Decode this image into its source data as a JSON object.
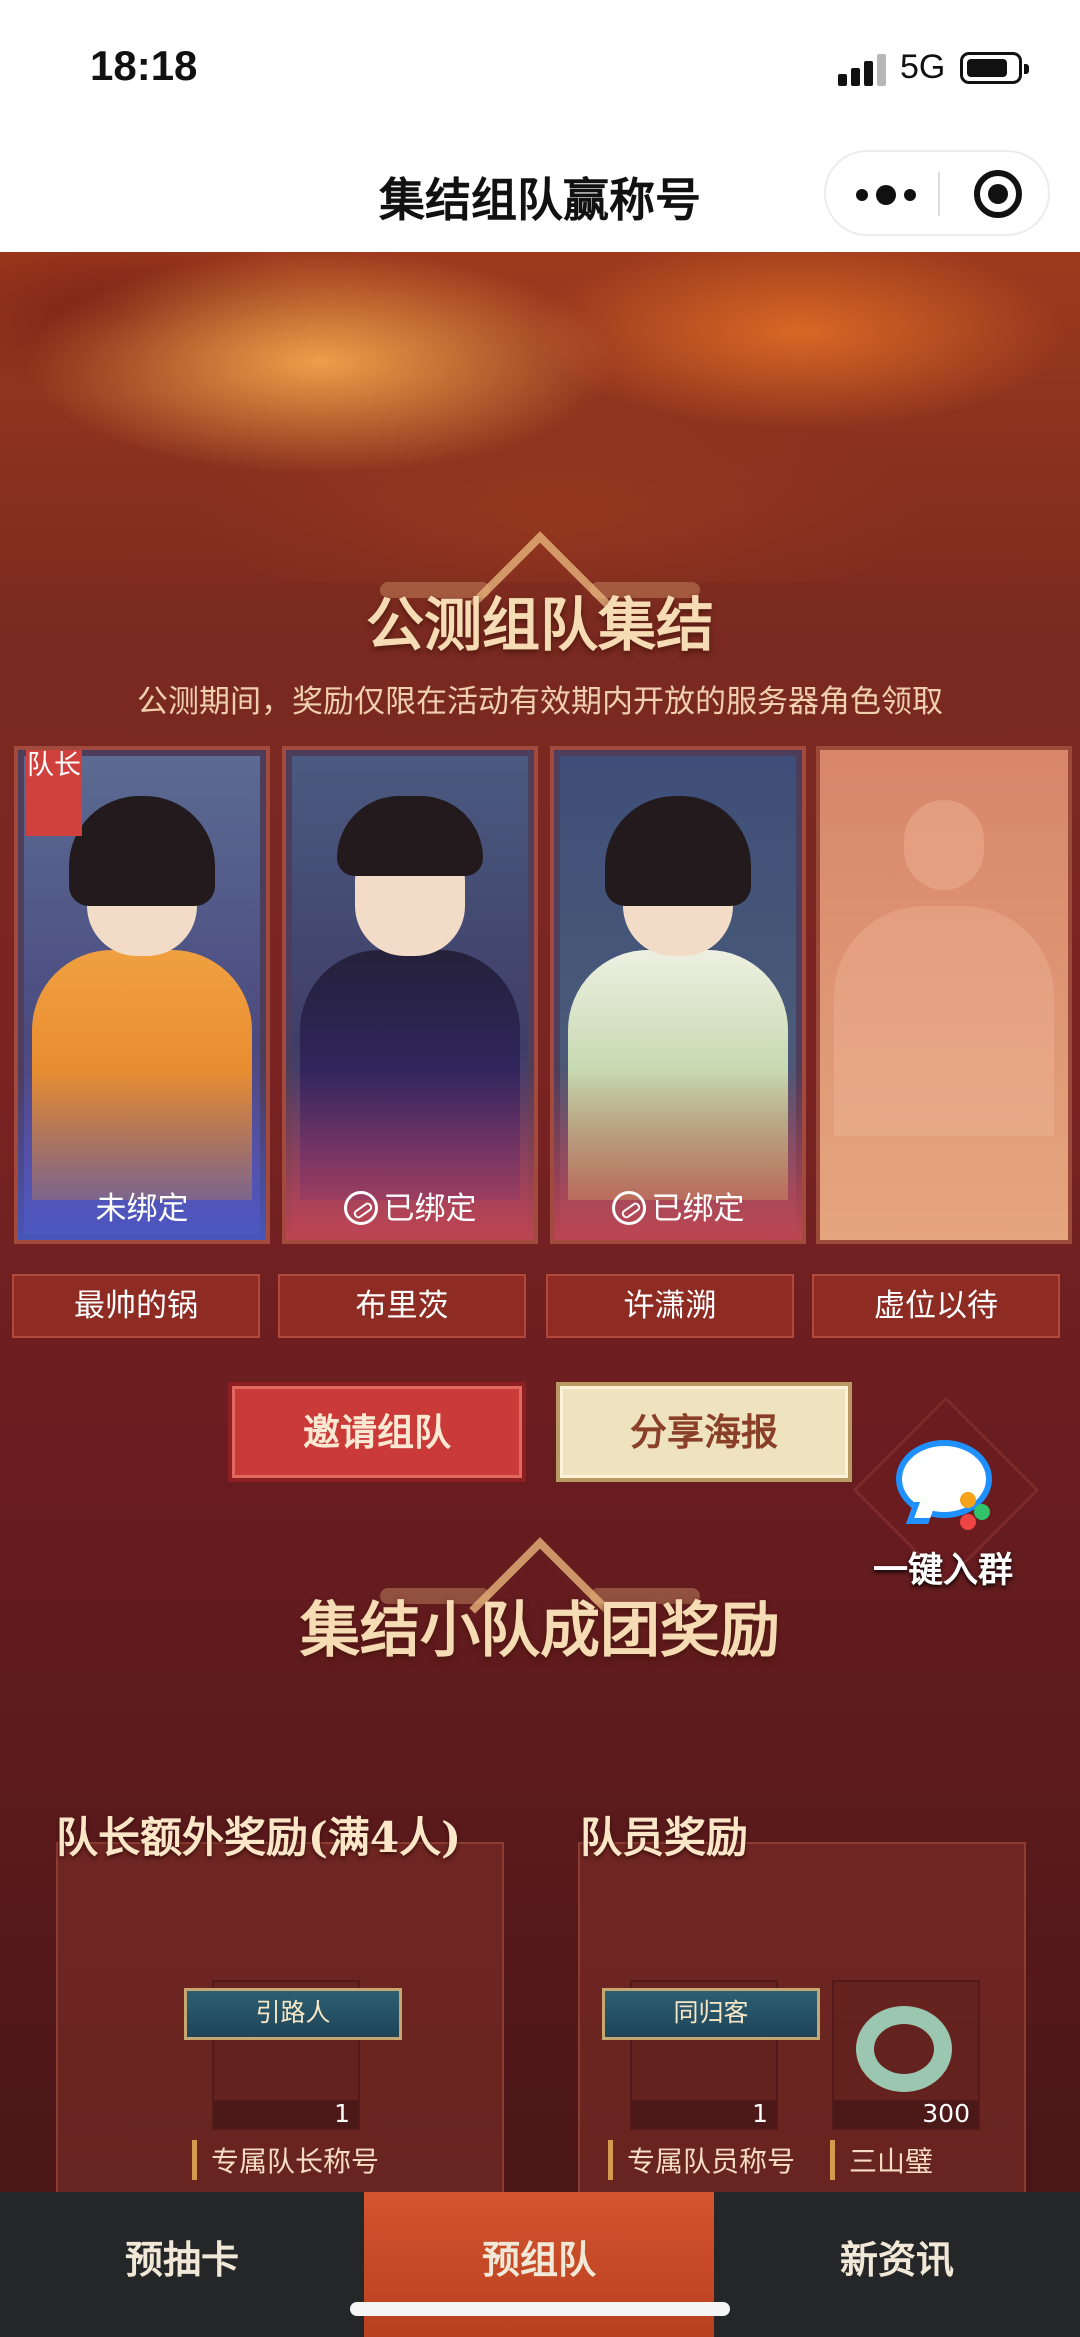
{
  "status_bar": {
    "time": "18:18",
    "network": "5G"
  },
  "header": {
    "title": "集结组队赢称号"
  },
  "team_section": {
    "title": "公测组队集结",
    "subtitle": "公测期间，奖励仅限在活动有效期内开放的服务器角色领取",
    "leader_tag": "队长",
    "members": [
      {
        "name": "最帅的锅",
        "status": "未绑定",
        "is_leader": true
      },
      {
        "name": "布里茨",
        "status": "已绑定"
      },
      {
        "name": "许潇溯",
        "status": "已绑定"
      },
      {
        "name": "虚位以待",
        "status": ""
      }
    ],
    "invite_button": "邀请组队",
    "share_button": "分享海报",
    "join_group": "一键入群"
  },
  "reward_section": {
    "title": "集结小队成团奖励",
    "leader_reward": {
      "heading": "队长额外奖励(满4人)",
      "items": [
        {
          "ribbon": "引路人",
          "qty": "1",
          "label": "专属队长称号"
        }
      ]
    },
    "member_reward": {
      "heading": "队员奖励",
      "items": [
        {
          "ribbon": "同归客",
          "qty": "1",
          "label": "专属队员称号"
        },
        {
          "qty": "300",
          "label": "三山璧"
        }
      ]
    }
  },
  "tabs": [
    {
      "label": "预抽卡"
    },
    {
      "label": "预组队",
      "active": true
    },
    {
      "label": "新资讯"
    }
  ],
  "colors": {
    "accent": "#c93a38",
    "tab_active": "#d4542e",
    "gold": "#f6dcb4"
  }
}
